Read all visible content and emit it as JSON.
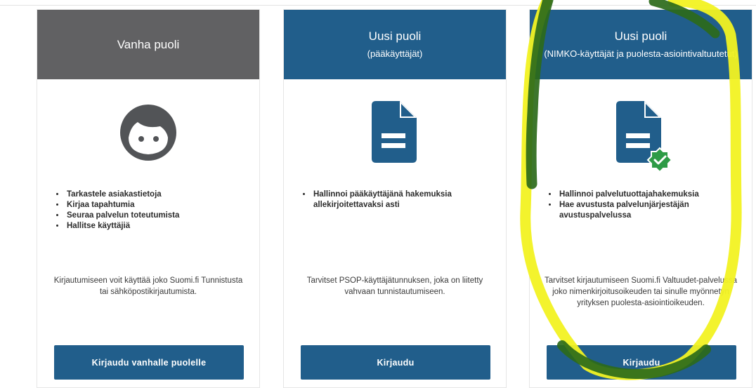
{
  "colors": {
    "old_header": "#616163",
    "new_header": "#215e8b",
    "button": "#215e8b",
    "check_badge": "#2e9b46",
    "highlight_yellow": "#f2f222",
    "highlight_green": "#2c6a1a"
  },
  "cards": [
    {
      "title": "Vanha puoli",
      "subtitle": "",
      "icon": "face-icon",
      "bullets": [
        "Tarkastele asiakastietoja",
        "Kirjaa tapahtumia",
        "Seuraa palvelun toteutumista",
        "Hallitse käyttäjiä"
      ],
      "description": "Kirjautumiseen voit käyttää joko Suomi.fi Tunnistusta tai sähköpostikirjautumista.",
      "button_label": "Kirjaudu vanhalle puolelle"
    },
    {
      "title": "Uusi puoli",
      "subtitle": "(pääkäyttäjät)",
      "icon": "document-icon",
      "bullets": [
        "Hallinnoi pääkäyttäjänä hakemuksia allekirjoitettavaksi asti"
      ],
      "description": "Tarvitset PSOP-käyttäjätunnuksen, joka on liitetty vahvaan tunnistautumiseen.",
      "button_label": "Kirjaudu"
    },
    {
      "title": "Uusi puoli",
      "subtitle": "(NIMKO-käyttäjät ja puolesta-asiointivaltuutetut)",
      "icon": "document-check-icon",
      "bullets": [
        "Hallinnoi palvelutuottajahakemuksia",
        "Hae avustusta palvelunjärjestäjän avustuspalvelussa"
      ],
      "description": "Tarvitset kirjautumiseen Suomi.fi Valtuudet-palvelussa joko nimenkirjoitusoikeuden tai sinulle myönnetyn yrityksen puolesta-asiointioikeuden.",
      "button_label": "Kirjaudu"
    }
  ]
}
